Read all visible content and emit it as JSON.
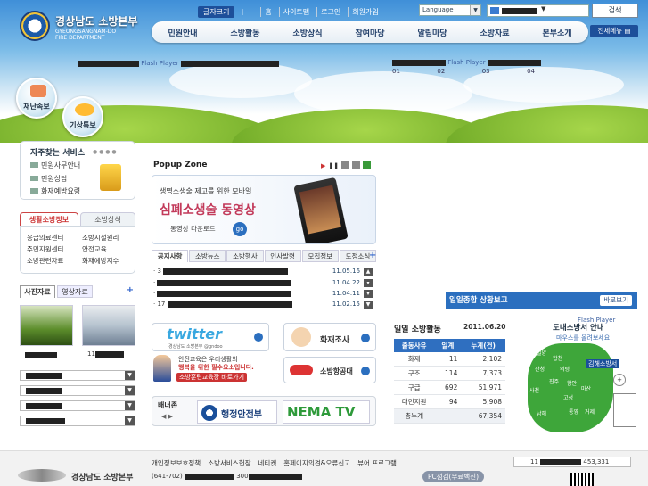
{
  "header": {
    "logo_title": "경상남도 소방본부",
    "logo_sub_line1": "GYEONGSANGNAM-DO",
    "logo_sub_line2": "FIRE DEPARTMENT",
    "font_size_label": "글자크기",
    "home_label": "홈",
    "sitemap_label": "사이트맵",
    "login_label": "로그인",
    "signup_label": "회원가입",
    "language_label": "Language",
    "search_button": "검색",
    "all_menu": "전체메뉴"
  },
  "nav": [
    "민원안내",
    "소방활동",
    "소방상식",
    "참여마당",
    "알림마당",
    "소방자료",
    "본부소개"
  ],
  "flash": {
    "left_text": "Flash Player",
    "right_text": "Flash Player",
    "numbers": [
      "01",
      "02",
      "03",
      "04"
    ]
  },
  "bubbles": {
    "disaster": "재난속보",
    "weather": "기상특보"
  },
  "frequent": {
    "title": "자주찾는 서비스",
    "items": [
      "민원사무안내",
      "민원상담",
      "화재예방요령"
    ]
  },
  "life_tabs": {
    "on": "생활소방정보",
    "off": "소방상식"
  },
  "services": [
    [
      "응급의료센터",
      "소방시설원리"
    ],
    [
      "주민지원센터",
      "안전교육"
    ],
    [
      "소방관련자료",
      "화재예방지수"
    ]
  ],
  "photo_tabs": {
    "photo": "사진자료",
    "video": "영상자료",
    "more": "+"
  },
  "photo_captions": [
    "11"
  ],
  "popup": {
    "title": "Popup Zone",
    "line1": "생명소생술 제고를 위한 모바일",
    "line2": "심폐소생술 동영상",
    "line3": "동영상 다운로드",
    "go": "go"
  },
  "notice_tabs": [
    "공지사항",
    "소방뉴스",
    "소방행사",
    "인사발령",
    "모집정보",
    "도정소식"
  ],
  "notice_more": "+",
  "notices": [
    {
      "prefix": "3",
      "date": "11.05.16"
    },
    {
      "prefix": "",
      "date": "11.04.22"
    },
    {
      "prefix": "",
      "date": "11.04.11"
    },
    {
      "prefix": "17",
      "date": "11.02.15"
    }
  ],
  "banners": {
    "twitter": "twitter",
    "twitter_sub": "경상남도 소방본부 @gndoo",
    "fire_investigation": "화재조사",
    "safety_line1": "안전교육은 우리생활의",
    "safety_line2": "행복을 위한 필수요소입니다.",
    "safety_btn": "소방훈련교육장 바로가기",
    "aviation": "소방항공대",
    "banner_zone": "배너존",
    "mopas": "행정안전부",
    "nema": "NEMA TV"
  },
  "status": {
    "title": "일일종합 상황보고",
    "more": "바로보기",
    "map_flash": "Flash Player",
    "map_title": "도내소방서 안내",
    "map_hint": "마우스를 올려보세요",
    "map_popup": "김해소방서",
    "regions": [
      "밀양",
      "함양",
      "합천",
      "의령",
      "창녕",
      "산청",
      "진주",
      "함안",
      "마산",
      "창원",
      "김해",
      "남해",
      "통영",
      "거제",
      "사천",
      "고성"
    ]
  },
  "daily": {
    "title": "일일 소방활동",
    "date": "2011.06.20",
    "headers": [
      "출동사유",
      "일계",
      "누계(건)"
    ],
    "rows": [
      [
        "화재",
        "11",
        "2,102"
      ],
      [
        "구조",
        "114",
        "7,373"
      ],
      [
        "구급",
        "692",
        "51,971"
      ],
      [
        "대민지원",
        "94",
        "5,908"
      ]
    ],
    "total_label": "총누계",
    "total_value": "67,354"
  },
  "footer": {
    "links": [
      "개인정보보호정책",
      "소방서비스헌장",
      "네티켓",
      "홈페이지의견&오류신고",
      "뷰어 프로그램"
    ],
    "logo": "경상남도 소방본부",
    "postal": "(641-702)",
    "addr_num": "300",
    "pc_check": "PC점검(무료백신)",
    "counter": "453,331",
    "counter_prefix": "11"
  }
}
